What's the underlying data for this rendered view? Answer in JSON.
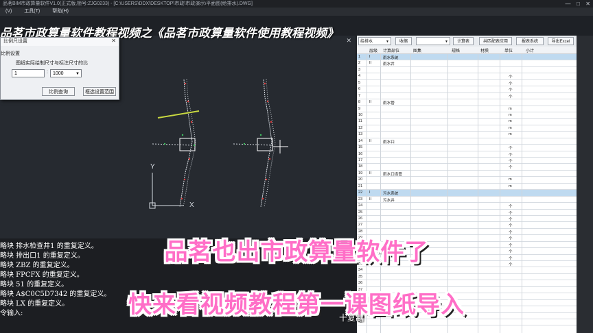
{
  "window": {
    "title": "品茗BIM市政算量软件V1.0(正式版,锁号:ZJG0233) - [C:\\USERS\\DDX\\DESKTOP\\市政\\市政演示\\平面图(给排水).DWG]",
    "controls": [
      "—",
      "□",
      "✕"
    ]
  },
  "menu": [
    "(V)",
    "工具(T)",
    "帮助(H)"
  ],
  "banner": "品茗市政算量软件教程视频之《品茗市政算量软件使用教程视频》",
  "dialog": {
    "title": "比例尺设置",
    "close": "✕",
    "group_label": "比例设置",
    "description": "图纸实际绘制尺寸与标注尺寸的比",
    "input_value": "1",
    "colon": ":",
    "select_value": "1000",
    "buttons": {
      "query": "比例查询",
      "range": "框选设置范围"
    }
  },
  "axis": {
    "y": "Y",
    "x": "X"
  },
  "command_lines": [
    "略块 排水检查井1 的重复定义。",
    "略块 排出口1 的重复定义。",
    "略块 ZBZ 的重复定义。",
    "略块 FPCFX 的重复定义。",
    "略块 51 的重复定义。",
    "略块 A$C0C5D7342 的重复定义。",
    "略块 LX 的重复定义。",
    "令输入:"
  ],
  "panel": {
    "toolbar": {
      "category": "给排水",
      "collapse": "收缩",
      "calc_table": "计算表",
      "config_apply": "共匹配表应用",
      "report": "报表系统",
      "export": "导出Excel"
    },
    "headers": [
      "层级",
      "计算部位",
      "图集",
      "规格",
      "材质",
      "单位",
      "小计"
    ],
    "rows": [
      {
        "n": "1",
        "level": "I",
        "part": "雨水系统",
        "unit": "",
        "group": true
      },
      {
        "n": "2",
        "level": "II",
        "part": "雨水井",
        "unit": "",
        "group": false
      },
      {
        "n": "3",
        "level": "",
        "part": "",
        "unit": "",
        "group": false
      },
      {
        "n": "4",
        "level": "",
        "part": "",
        "unit": "个",
        "group": false
      },
      {
        "n": "5",
        "level": "",
        "part": "",
        "unit": "个",
        "group": false
      },
      {
        "n": "6",
        "level": "",
        "part": "",
        "unit": "个",
        "group": false
      },
      {
        "n": "7",
        "level": "",
        "part": "",
        "unit": "个",
        "group": false
      },
      {
        "n": "8",
        "level": "II",
        "part": "雨水管",
        "unit": "",
        "group": false
      },
      {
        "n": "9",
        "level": "",
        "part": "",
        "unit": "m",
        "group": false
      },
      {
        "n": "10",
        "level": "",
        "part": "",
        "unit": "m",
        "group": false
      },
      {
        "n": "11",
        "level": "",
        "part": "",
        "unit": "m",
        "group": false
      },
      {
        "n": "12",
        "level": "",
        "part": "",
        "unit": "m",
        "group": false
      },
      {
        "n": "13",
        "level": "",
        "part": "",
        "unit": "m",
        "group": false
      },
      {
        "n": "14",
        "level": "II",
        "part": "雨水口",
        "unit": "",
        "group": false
      },
      {
        "n": "15",
        "level": "",
        "part": "",
        "unit": "个",
        "group": false
      },
      {
        "n": "16",
        "level": "",
        "part": "",
        "unit": "个",
        "group": false
      },
      {
        "n": "17",
        "level": "",
        "part": "",
        "unit": "个",
        "group": false
      },
      {
        "n": "18",
        "level": "",
        "part": "",
        "unit": "个",
        "group": false
      },
      {
        "n": "19",
        "level": "II",
        "part": "雨水口连管",
        "unit": "",
        "group": false
      },
      {
        "n": "20",
        "level": "",
        "part": "",
        "unit": "m",
        "group": false
      },
      {
        "n": "21",
        "level": "",
        "part": "",
        "unit": "m",
        "group": false
      },
      {
        "n": "22",
        "level": "I",
        "part": "污水系统",
        "unit": "",
        "group": true
      },
      {
        "n": "23",
        "level": "II",
        "part": "污水井",
        "unit": "",
        "group": false
      },
      {
        "n": "24",
        "level": "",
        "part": "",
        "unit": "个",
        "group": false
      },
      {
        "n": "25",
        "level": "",
        "part": "",
        "unit": "个",
        "group": false
      },
      {
        "n": "26",
        "level": "",
        "part": "",
        "unit": "个",
        "group": false
      },
      {
        "n": "27",
        "level": "",
        "part": "",
        "unit": "个",
        "group": false
      },
      {
        "n": "28",
        "level": "",
        "part": "",
        "unit": "个",
        "group": false
      },
      {
        "n": "29",
        "level": "",
        "part": "",
        "unit": "个",
        "group": false
      },
      {
        "n": "30",
        "level": "",
        "part": "",
        "unit": "个",
        "group": false
      },
      {
        "n": "31",
        "level": "",
        "part": "",
        "unit": "个",
        "group": false
      },
      {
        "n": "32",
        "level": "",
        "part": "",
        "unit": "个",
        "group": false
      },
      {
        "n": "33",
        "level": "",
        "part": "",
        "unit": "个",
        "group": false
      },
      {
        "n": "34",
        "level": "",
        "part": "",
        "unit": "",
        "group": false
      },
      {
        "n": "35",
        "level": "",
        "part": "",
        "unit": "",
        "group": false
      },
      {
        "n": "36",
        "level": "",
        "part": "",
        "unit": "",
        "group": false
      },
      {
        "n": "37",
        "level": "",
        "part": "",
        "unit": "",
        "group": false
      },
      {
        "n": "38",
        "level": "",
        "part": "",
        "unit": "",
        "group": false
      },
      {
        "n": "39",
        "level": "",
        "part": "",
        "unit": "",
        "group": false
      },
      {
        "n": "40",
        "level": "",
        "part": "",
        "unit": "",
        "group": false
      },
      {
        "n": "41",
        "level": "",
        "part": "",
        "unit": "",
        "group": false
      },
      {
        "n": "42",
        "level": "",
        "part": "",
        "unit": "",
        "group": false
      }
    ]
  },
  "captions": {
    "line1": "品茗也出市政算量软件了",
    "line2": "快来看视频教程第一课图纸导入",
    "small": "十复制"
  },
  "colors": {
    "caption_pink": "#ff6ec7",
    "group_row": "#bfdaf0",
    "cad_bg": "#262a30"
  }
}
